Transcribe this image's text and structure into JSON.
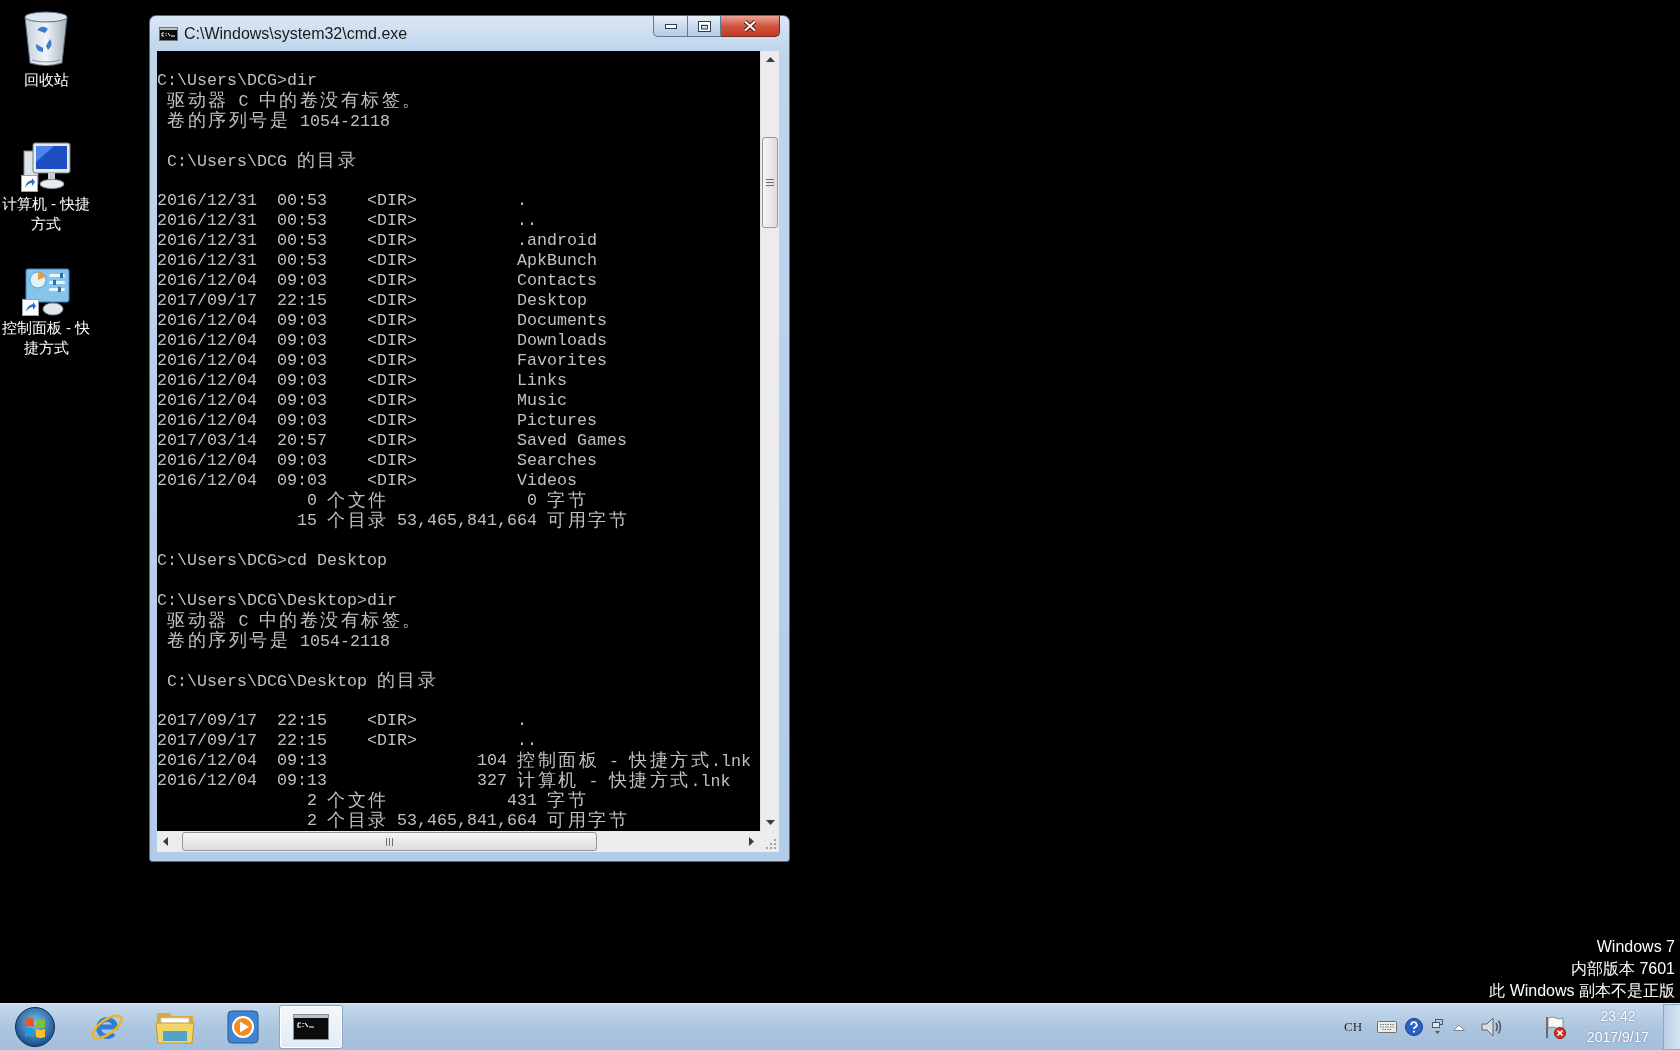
{
  "desktop_icons": [
    {
      "kind": "bin",
      "label": "回收站"
    },
    {
      "kind": "computer",
      "label": "计算机 - 快捷方式"
    },
    {
      "kind": "panel",
      "label": "控制面板 - 快捷方式"
    }
  ],
  "console_window": {
    "title": "C:\\Windows\\system32\\cmd.exe",
    "blocks": [
      [
        {
          "kind": "command",
          "text": "C:\\Users\\DCG>dir"
        },
        {
          "kind": "info",
          "text": "驱动器 C 中的卷没有标签。"
        },
        {
          "kind": "info",
          "text": "卷的序列号是 1054-2118"
        }
      ],
      [
        {
          "kind": "info",
          "text": "C:\\Users\\DCG 的目录"
        }
      ],
      [
        {
          "kind": "dir",
          "date": "2016/12/31",
          "time": "00:53",
          "tag": "<DIR>",
          "name": "."
        },
        {
          "kind": "dir",
          "date": "2016/12/31",
          "time": "00:53",
          "tag": "<DIR>",
          "name": ".."
        },
        {
          "kind": "dir",
          "date": "2016/12/31",
          "time": "00:53",
          "tag": "<DIR>",
          "name": ".android"
        },
        {
          "kind": "dir",
          "date": "2016/12/31",
          "time": "00:53",
          "tag": "<DIR>",
          "name": "ApkBunch"
        },
        {
          "kind": "dir",
          "date": "2016/12/04",
          "time": "09:03",
          "tag": "<DIR>",
          "name": "Contacts"
        },
        {
          "kind": "dir",
          "date": "2017/09/17",
          "time": "22:15",
          "tag": "<DIR>",
          "name": "Desktop"
        },
        {
          "kind": "dir",
          "date": "2016/12/04",
          "time": "09:03",
          "tag": "<DIR>",
          "name": "Documents"
        },
        {
          "kind": "dir",
          "date": "2016/12/04",
          "time": "09:03",
          "tag": "<DIR>",
          "name": "Downloads"
        },
        {
          "kind": "dir",
          "date": "2016/12/04",
          "time": "09:03",
          "tag": "<DIR>",
          "name": "Favorites"
        },
        {
          "kind": "dir",
          "date": "2016/12/04",
          "time": "09:03",
          "tag": "<DIR>",
          "name": "Links"
        },
        {
          "kind": "dir",
          "date": "2016/12/04",
          "time": "09:03",
          "tag": "<DIR>",
          "name": "Music"
        },
        {
          "kind": "dir",
          "date": "2016/12/04",
          "time": "09:03",
          "tag": "<DIR>",
          "name": "Pictures"
        },
        {
          "kind": "dir",
          "date": "2017/03/14",
          "time": "20:57",
          "tag": "<DIR>",
          "name": "Saved Games"
        },
        {
          "kind": "dir",
          "date": "2016/12/04",
          "time": "09:03",
          "tag": "<DIR>",
          "name": "Searches"
        },
        {
          "kind": "dir",
          "date": "2016/12/04",
          "time": "09:03",
          "tag": "<DIR>",
          "name": "Videos"
        },
        {
          "kind": "total",
          "count": "0",
          "label": "个文件",
          "size": "0",
          "unit": "字节"
        },
        {
          "kind": "total",
          "count": "15",
          "label": "个目录",
          "size": "53,465,841,664",
          "unit": "可用字节"
        }
      ],
      [
        {
          "kind": "command",
          "text": "C:\\Users\\DCG>cd Desktop"
        }
      ],
      [
        {
          "kind": "command",
          "text": "C:\\Users\\DCG\\Desktop>dir"
        },
        {
          "kind": "info",
          "text": "驱动器 C 中的卷没有标签。"
        },
        {
          "kind": "info",
          "text": "卷的序列号是 1054-2118"
        }
      ],
      [
        {
          "kind": "info",
          "text": "C:\\Users\\DCG\\Desktop 的目录"
        }
      ],
      [
        {
          "kind": "dir",
          "date": "2017/09/17",
          "time": "22:15",
          "tag": "<DIR>",
          "name": "."
        },
        {
          "kind": "dir",
          "date": "2017/09/17",
          "time": "22:15",
          "tag": "<DIR>",
          "name": ".."
        },
        {
          "kind": "file",
          "date": "2016/12/04",
          "time": "09:13",
          "size": "104",
          "name": "控制面板 - 快捷方式.lnk"
        },
        {
          "kind": "file",
          "date": "2016/12/04",
          "time": "09:13",
          "size": "327",
          "name": "计算机 - 快捷方式.lnk"
        },
        {
          "kind": "total",
          "count": "2",
          "label": "个文件",
          "size": "431",
          "unit": "字节"
        },
        {
          "kind": "total",
          "count": "2",
          "label": "个目录",
          "size": "53,465,841,664",
          "unit": "可用字节"
        }
      ]
    ]
  },
  "desktop_notice": [
    "Windows 7",
    "内部版本 7601",
    "此 Windows 副本不是正版"
  ],
  "taskbar": {
    "buttons": [
      {
        "kind": "browser",
        "selected": false
      },
      {
        "kind": "folder",
        "selected": false
      },
      {
        "kind": "player",
        "selected": false
      },
      {
        "kind": "console",
        "selected": true
      }
    ],
    "language": "CH",
    "clock": {
      "time": "23:42",
      "date": "2017/9/17"
    }
  }
}
